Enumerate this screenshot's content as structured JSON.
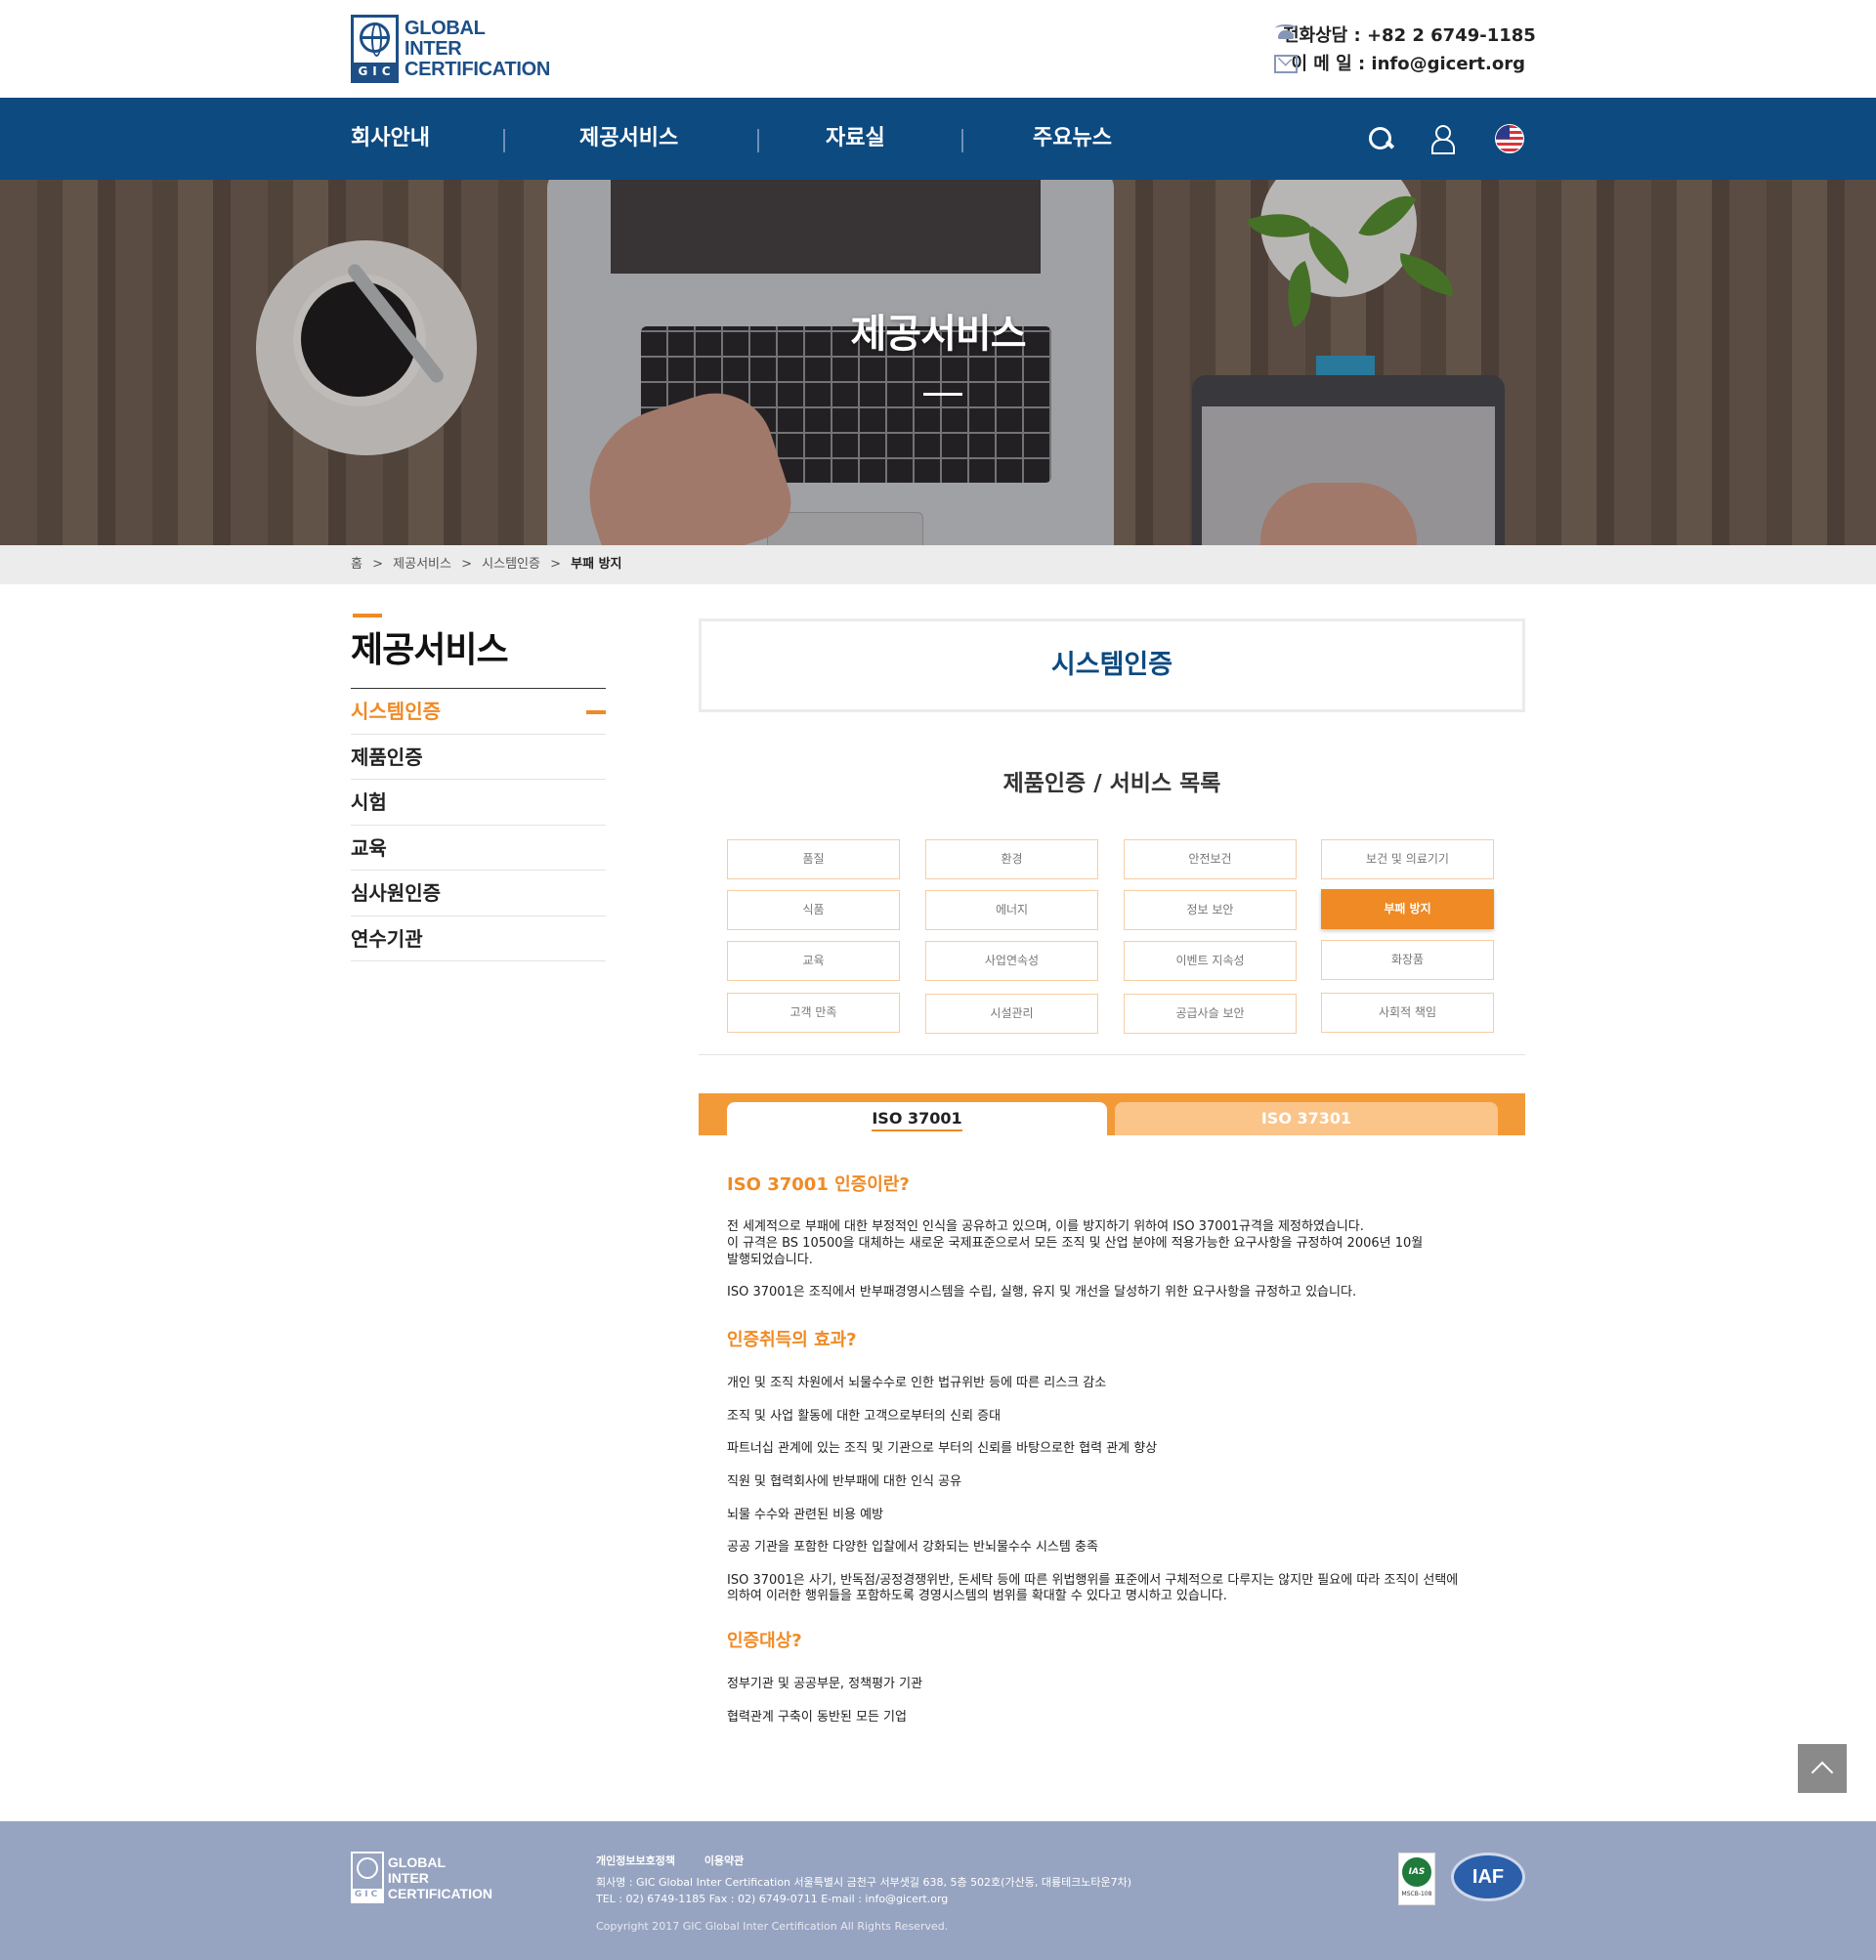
{
  "brand": {
    "logo_lines": [
      "GLOBAL",
      "INTER",
      "CERTIFICATION"
    ],
    "logo_mark": "GIC",
    "accent_color": "#f08a24",
    "primary_color": "#0d4a80"
  },
  "contact": {
    "phone": "전화상담 : +82 2 6749-1185",
    "email": "이 메 일 : info@gicert.org"
  },
  "nav": {
    "items": [
      "회사안내",
      "제공서비스",
      "자료실",
      "주요뉴스"
    ],
    "icons": [
      "search-icon",
      "user-icon",
      "us-flag-icon"
    ]
  },
  "hero": {
    "title": "제공서비스"
  },
  "breadcrumb": {
    "items": [
      "홈",
      ">",
      "제공서비스",
      ">",
      "시스템인증",
      ">"
    ],
    "current": "부패 방지"
  },
  "sidebar": {
    "title": "제공서비스",
    "items": [
      {
        "label": "시스템인증",
        "active": true
      },
      {
        "label": "제품인증"
      },
      {
        "label": "시험"
      },
      {
        "label": "교육"
      },
      {
        "label": "심사원인증"
      },
      {
        "label": "연수기관"
      }
    ]
  },
  "content": {
    "page_heading": "시스템인증",
    "list_title": "제품인증 / 서비스 목록",
    "services": [
      [
        "품질",
        "환경",
        "안전보건",
        "보건 및 의료기기"
      ],
      [
        "식품",
        "에너지",
        "정보 보안",
        "부패 방지"
      ],
      [
        "교육",
        "사업연속성",
        "이벤트 지속성",
        "화장품"
      ],
      [
        "고객 만족",
        "시설관리",
        "공급사슬 보안",
        "사회적 책임"
      ]
    ],
    "active_service": "부패 방지",
    "tabs": [
      {
        "label": "ISO 37001",
        "active": true
      },
      {
        "label": "ISO 37301",
        "active": false
      }
    ],
    "section1": {
      "heading": "ISO 37001 인증이란?",
      "p1": [
        "전 세계적으로 부패에 대한 부정적인 인식을 공유하고 있으며, 이를 방지하기 위하여 ISO 37001규격을 제정하였습니다.",
        "이 규격은 BS 10500을 대체하는 새로운 국제표준으로서 모든 조직 및 산업 분야에 적용가능한 요구사항을 규정하여 2006년 10월",
        "발행되었습니다."
      ],
      "p2": "ISO 37001은 조직에서 반부패경영시스템을 수립, 실행, 유지 및 개선을 달성하기 위한 요구사항을 규정하고 있습니다."
    },
    "section2": {
      "heading": "인증취득의 효과?",
      "items": [
        "개인 및 조직 차원에서 뇌물수수로 인한 법규위반 등에 따른 리스크 감소",
        "조직 및 사업 활동에 대한 고객으로부터의 신뢰 증대",
        "파트너십 관계에 있는 조직 및 기관으로 부터의 신뢰를 바탕으로한 협력 관계 향상",
        "직원 및 협력회사에 반부패에 대한 인식 공유",
        "뇌물 수수와 관련된 비용 예방",
        "공공 기관을 포함한 다양한 입찰에서 강화되는 반뇌물수수 시스템 충족"
      ],
      "note": [
        "ISO 37001은 사기, 반독점/공정경쟁위반, 돈세탁 등에 따른 위법행위를 표준에서 구체적으로 다루지는 않지만 필요에 따라 조직이 선택에",
        "의하여 이러한 행위들을 포함하도록 경영시스템의 범위를 확대할 수 있다고 명시하고 있습니다."
      ]
    },
    "section3": {
      "heading": "인증대상?",
      "items": [
        "정부기관 및 공공부문, 정책평가 기관",
        "협력관계 구축이 동반된 모든 기업"
      ]
    }
  },
  "footer": {
    "logo_lines": [
      "GLOBAL",
      "INTER",
      "CERTIFICATION"
    ],
    "links": [
      "개인정보보호정책",
      "이용약관"
    ],
    "info": [
      "회사명 : GIC Global Inter Certification   서울특별시 금천구 서부샛길 638, 5층 502호(가산동, 대륭테크노타운7차)",
      "TEL : 02) 6749-1185 Fax : 02) 6749-0711 E-mail : info@gicert.org"
    ],
    "copyright": "Copyright 2017 GIC Global Inter Certification All Rights Reserved.",
    "badges": [
      "IAS",
      "IAF"
    ],
    "ias_caption": "MSCB-108"
  },
  "controls": {
    "scroll_top": "scroll-to-top"
  }
}
